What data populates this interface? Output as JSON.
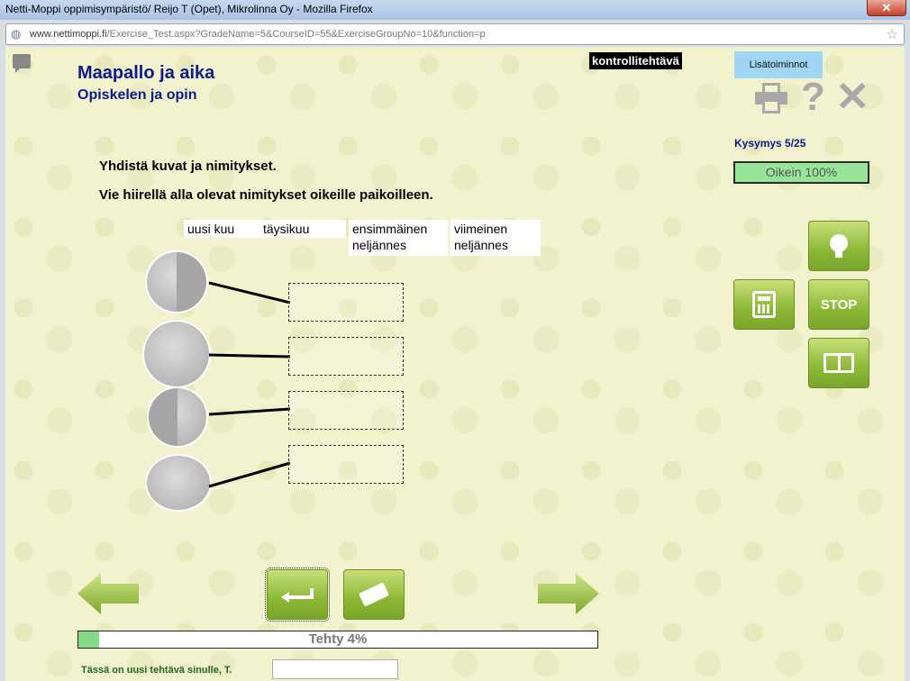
{
  "window": {
    "title": "Netti-Moppi oppimisympäristö/ Reijo T (Opet), Mikrolinna Oy - Mozilla Firefox",
    "close_glyph": "✕"
  },
  "address_bar": {
    "url_host": "www.nettimoppi.fi",
    "url_path": "/Exercise_Test.aspx?GradeName=5&CourseID=55&ExerciseGroupNo=10&function=p"
  },
  "header": {
    "title": "Maapallo ja aika",
    "subtitle": "Opiskelen ja opin"
  },
  "top_right": {
    "kontrolli": "kontrollitehtävä",
    "lisa_button": "Lisätoiminnot",
    "help_glyph": "?",
    "close_glyph": "✕"
  },
  "status": {
    "question": "Kysymys 5/25",
    "correct": "Oikein 100%"
  },
  "instructions": {
    "line1": "Yhdistä kuvat ja nimitykset.",
    "line2": "Vie hiirellä alla olevat nimitykset oikeille paikoilleen."
  },
  "words": [
    "uusi kuu",
    "täysikuu",
    "ensimmäinen neljännes",
    "viimeinen neljännes"
  ],
  "side_buttons": {
    "stop_label": "STOP"
  },
  "progress": {
    "label": "Tehty 4%",
    "value_percent": 4
  },
  "footer": {
    "message": "Tässä on uusi tehtävä sinulle, T."
  },
  "colors": {
    "title_blue": "#0a1a8a",
    "button_green": "#8cb836",
    "correct_green": "#97e59b",
    "background": "#f2f2cf"
  }
}
